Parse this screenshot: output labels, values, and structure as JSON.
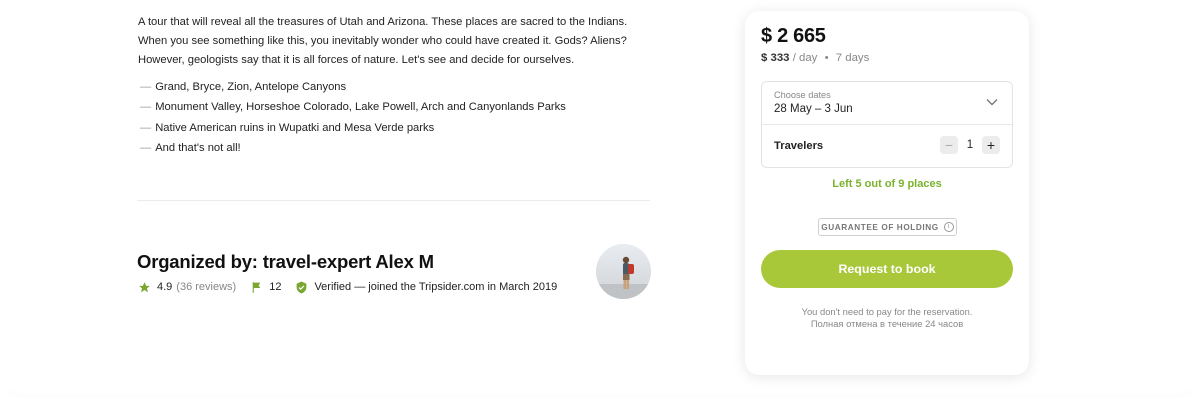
{
  "tour": {
    "description": "A tour that will reveal all the treasures of Utah and Arizona. These places are sacred to the Indians. When you see something like this, you inevitably wonder who could have created it. Gods? Aliens? However, geologists say that it is all forces of nature. Let's see and decide for ourselves.",
    "highlights": [
      "Grand, Bryce, Zion, Antelope Canyons",
      "Monument Valley, Horseshoe Colorado, Lake Powell, Arch and Canyonlands Parks",
      "Native American ruins in Wupatki and Mesa Verde parks",
      "And that's not all!"
    ],
    "dash": "—"
  },
  "organizer": {
    "title": "Organized by: travel-expert Alex M",
    "rating": "4.9",
    "reviews": "(36 reviews)",
    "trips": "12",
    "verified": "Verified — joined the Tripsider.com in March 2019"
  },
  "booking": {
    "price": "$ 2 665",
    "per_day_amount": "$ 333",
    "per_day_unit": "/ day",
    "separator": "•",
    "duration": "7 days",
    "dates_label": "Choose dates",
    "dates_value": "28 May – 3 Jun",
    "travelers_label": "Travelers",
    "minus": "−",
    "travelers_count": "1",
    "plus": "+",
    "left_places": "Left 5 out of 9 places",
    "guarantee": "GUARANTEE OF HOLDING",
    "info": "i",
    "button": "Request to book",
    "note_line1": "You don't need to pay for the reservation.",
    "note_line2": "Полная отмена в течение 24 часов"
  },
  "colors": {
    "accent": "#a8c83a",
    "accent_text": "#7ab22e",
    "icon_green": "#7aa632"
  },
  "icons": {
    "rating": "star-icon",
    "trips": "flag-icon",
    "verified": "shield-check-icon",
    "dates": "chevron-down-icon",
    "guarantee": "info-icon"
  }
}
